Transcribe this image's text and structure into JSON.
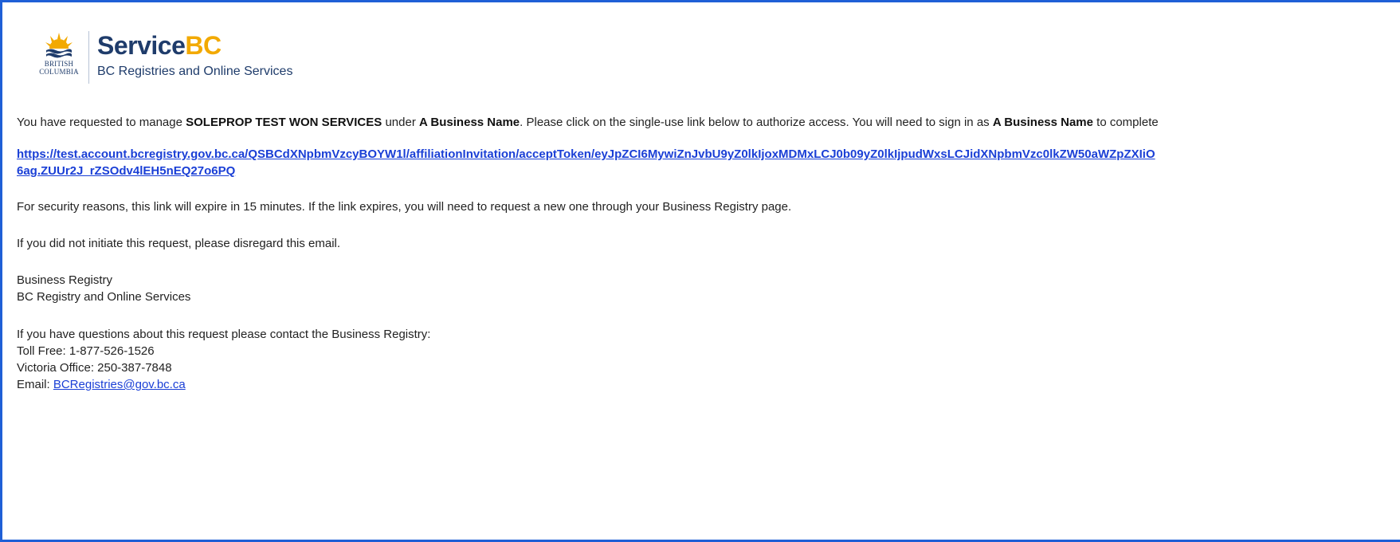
{
  "header": {
    "brand_prefix": "Service",
    "brand_suffix": "BC",
    "subtitle": "BC Registries and Online Services",
    "logo_line1": "BRITISH",
    "logo_line2": "COLUMBIA"
  },
  "email": {
    "intro_part1": "You have requested to manage ",
    "business_bold": "SOLEPROP TEST WON SERVICES",
    "intro_part2": " under ",
    "name_bold": "A Business Name",
    "intro_part3": ". Please click on the single-use link below to authorize access. You will need to sign in as ",
    "name_bold2": "A Business Name",
    "intro_part4": " to complete",
    "link_line1": "https://test.account.bcregistry.gov.bc.ca/QSBCdXNpbmVzcyBOYW1l/affiliationInvitation/acceptToken/eyJpZCI6MywiZnJvbU9yZ0lkIjoxMDMxLCJ0b09yZ0lkIjpudWxsLCJidXNpbmVzc0lkZW50aWZpZXIiO",
    "link_line2": "6ag.ZUUr2J_rZSOdv4lEH5nEQ27o6PQ",
    "security_note": "For security reasons, this link will expire in 15 minutes. If the link expires, you will need to request a new one through your Business Registry page.",
    "disregard_note": "If you did not initiate this request, please disregard this email.",
    "signature_line1": "Business Registry",
    "signature_line2": "BC Registry and Online Services",
    "contact_intro": "If you have questions about this request please contact the Business Registry:",
    "toll_free": "Toll Free: 1-877-526-1526",
    "victoria_office": "Victoria Office: 250-387-7848",
    "email_label": "Email: ",
    "email_address": "BCRegistries@gov.bc.ca"
  },
  "colors": {
    "frame_border": "#1f5fd6",
    "brand_navy": "#1f3c6b",
    "brand_gold": "#f2a900",
    "link_blue": "#1a3fd6"
  },
  "icons": {
    "logo": "bc-government-sun-logo"
  }
}
